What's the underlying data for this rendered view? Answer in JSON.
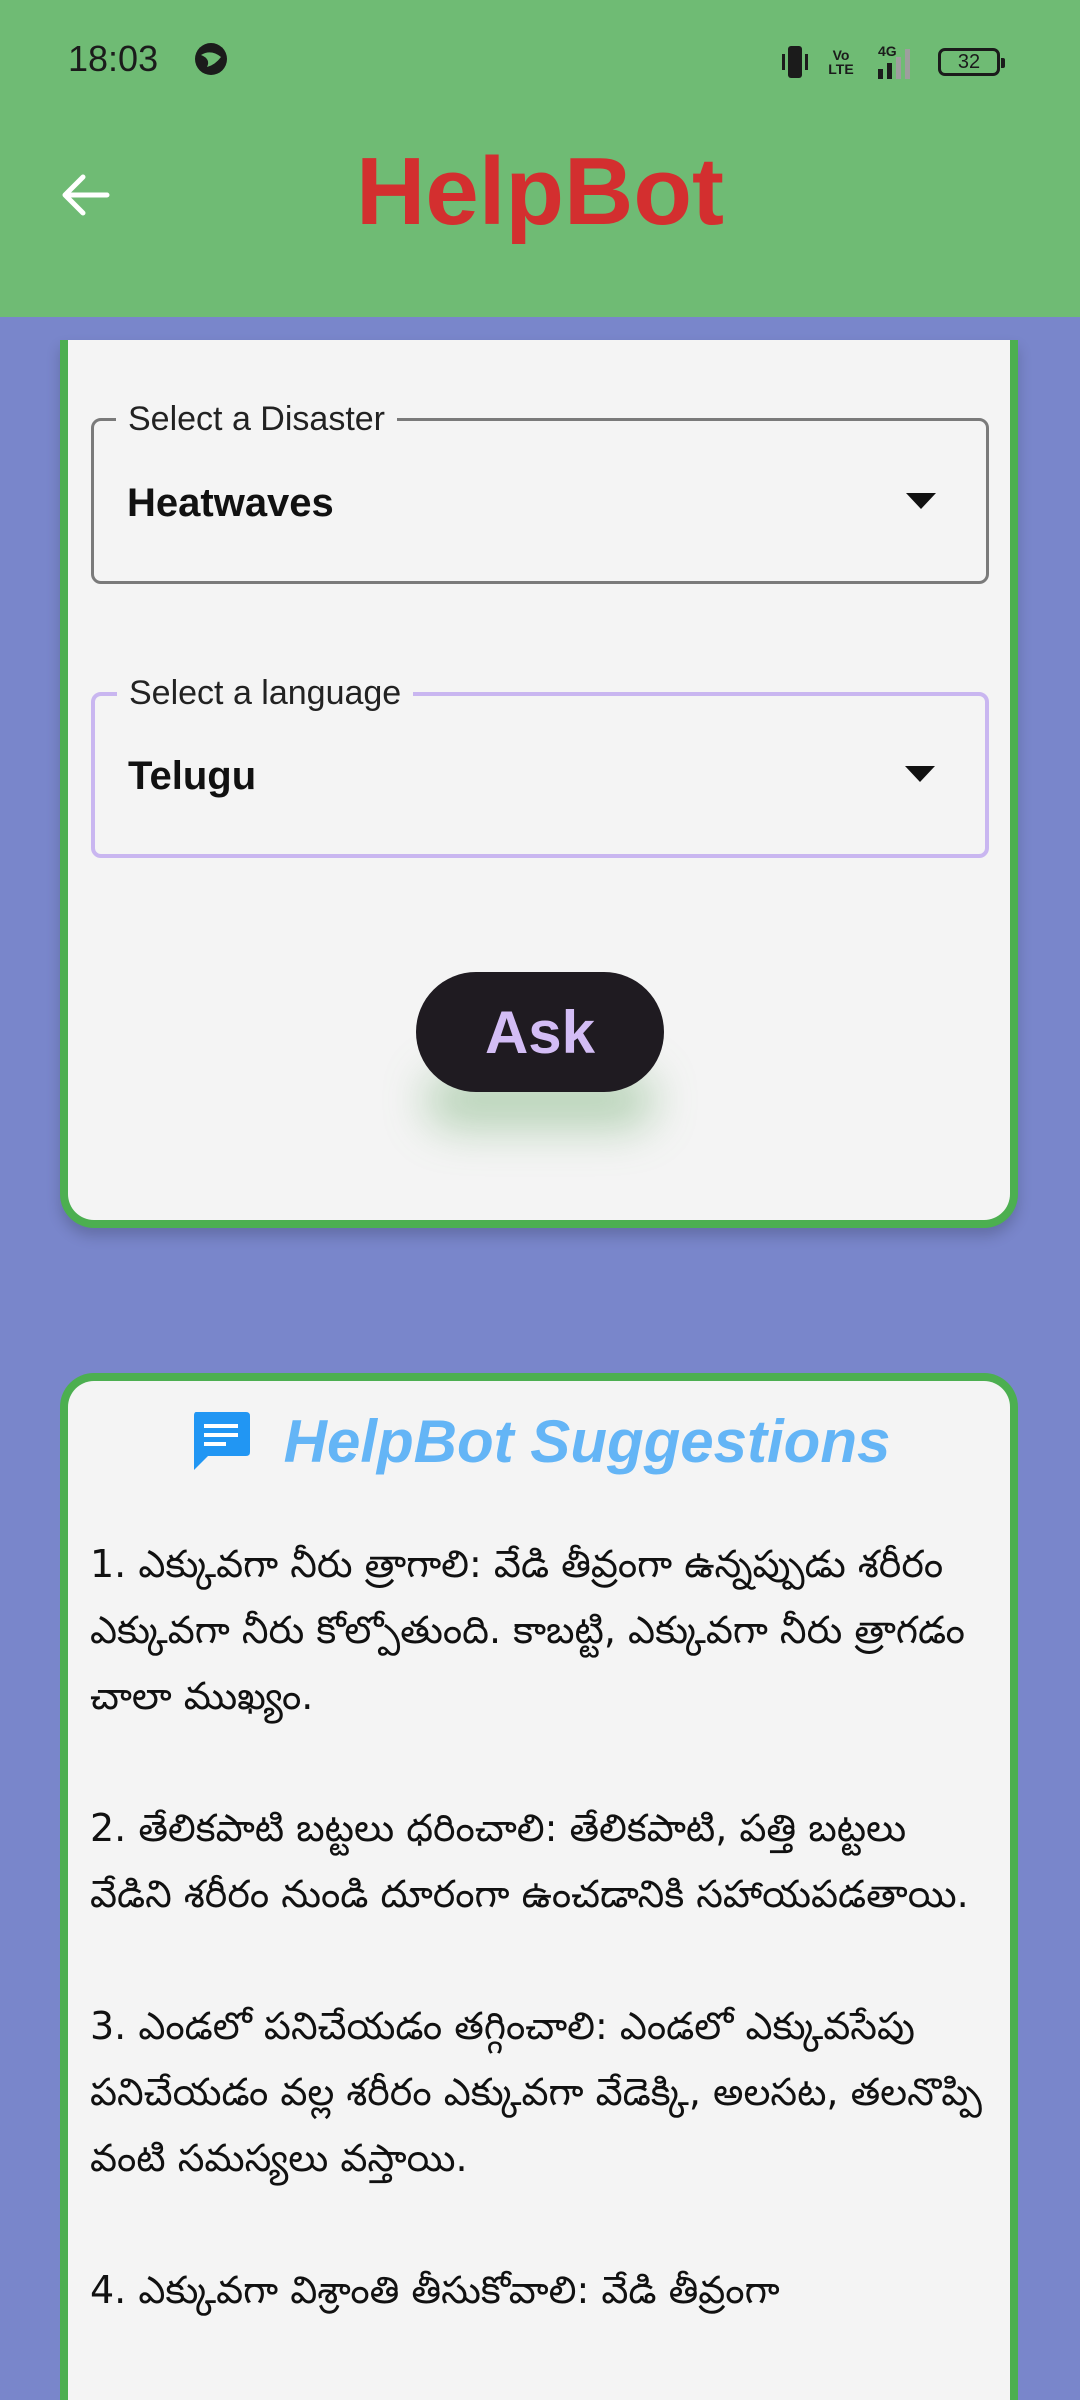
{
  "status_bar": {
    "time": "18:03",
    "network_label": "Vo\nLTE",
    "signal_label": "4G",
    "battery": "32"
  },
  "app_bar": {
    "title": "HelpBot",
    "title_color": "#d32f2f",
    "background": "#6fbb74",
    "back_icon": "arrow-left-icon"
  },
  "form": {
    "disaster": {
      "label": "Select a Disaster",
      "value": "Heatwaves"
    },
    "language": {
      "label": "Select a language",
      "value": "Telugu"
    },
    "ask_label": "Ask"
  },
  "suggestions": {
    "title": "HelpBot Suggestions",
    "icon": "chat-bubble-icon",
    "items": [
      "1. ఎక్కువగా నీరు త్రాగాలి: వేడి తీవ్రంగా ఉన్నప్పుడు శరీరం ఎక్కువగా నీరు కోల్పోతుంది. కాబట్టి, ఎక్కువగా నీరు త్రాగడం చాలా ముఖ్యం.",
      "2. తేలికపాటి బట్టలు ధరించాలి:  తేలికపాటి, పత్తి బట్టలు వేడిని శరీరం నుండి దూరంగా ఉంచడానికి సహాయపడతాయి.",
      "3. ఎండలో పనిచేయడం తగ్గించాలి:  ఎండలో ఎక్కువసేపు పనిచేయడం వల్ల శరీరం ఎక్కువగా వేడెక్కి, అలసట, తలనొప్పి వంటి సమస్యలు వస్తాయి.",
      "4. ఎక్కువగా విశ్రాంతి తీసుకోవాలి:  వేడి తీవ్రంగా"
    ]
  },
  "colors": {
    "page_background": "#7986cb",
    "card_border": "#4caf50",
    "card_background": "#f4f4f4",
    "ask_button_bg": "#1f1b21",
    "ask_button_text": "#d3bdf5",
    "suggestion_title": "#64b5f6"
  }
}
